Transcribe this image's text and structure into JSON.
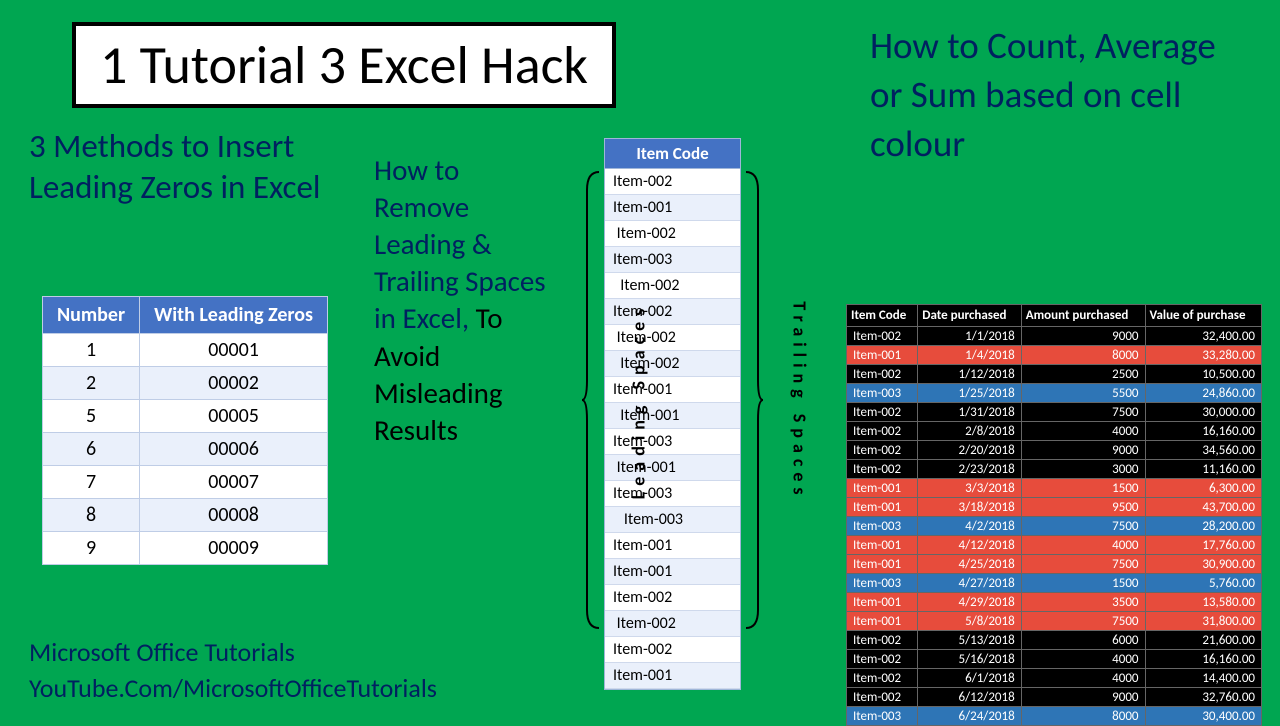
{
  "title": "1 Tutorial 3 Excel Hack",
  "methods_text": "3 Methods to Insert Leading Zeros in Excel",
  "leading_table": {
    "headers": [
      "Number",
      "With Leading Zeros"
    ],
    "rows": [
      [
        "1",
        "00001"
      ],
      [
        "2",
        "00002"
      ],
      [
        "5",
        "00005"
      ],
      [
        "6",
        "00006"
      ],
      [
        "7",
        "00007"
      ],
      [
        "8",
        "00008"
      ],
      [
        "9",
        "00009"
      ]
    ]
  },
  "footer_line1": "Microsoft Office Tutorials",
  "footer_line2": "YouTube.Com/MicrosoftOfficeTutorials",
  "spaces_text_blue": "How to Remove Leading & Trailing Spaces in Excel, ",
  "spaces_text_black": "To Avoid Misleading Results",
  "item_code_header": "Item Code",
  "item_codes": [
    "Item-002",
    "Item-001",
    " Item-002",
    "Item-003",
    "  Item-002",
    "Item-002",
    " Item-002",
    "  Item-002",
    "Item-001",
    "  Item-001",
    "Item-003",
    " Item-001",
    "Item-003",
    "   Item-003",
    "Item-001",
    "Item-001",
    "Item-002",
    " Item-002",
    "Item-002",
    "Item-001"
  ],
  "leading_spaces_label": "Leading Spaces",
  "trailing_spaces_label": "Trailing Spaces",
  "count_text": "How to Count, Average or Sum based on cell colour",
  "color_table": {
    "headers": [
      "Item Code",
      "Date purchased",
      "Amount purchased",
      "Value of purchase"
    ],
    "rows": [
      {
        "c": "black",
        "v": [
          "Item-002",
          "1/1/2018",
          "9000",
          "32,400.00"
        ]
      },
      {
        "c": "red",
        "v": [
          "Item-001",
          "1/4/2018",
          "8000",
          "33,280.00"
        ]
      },
      {
        "c": "black",
        "v": [
          "Item-002",
          "1/12/2018",
          "2500",
          "10,500.00"
        ]
      },
      {
        "c": "blue",
        "v": [
          "Item-003",
          "1/25/2018",
          "5500",
          "24,860.00"
        ]
      },
      {
        "c": "black",
        "v": [
          "Item-002",
          "1/31/2018",
          "7500",
          "30,000.00"
        ]
      },
      {
        "c": "black",
        "v": [
          "Item-002",
          "2/8/2018",
          "4000",
          "16,160.00"
        ]
      },
      {
        "c": "black",
        "v": [
          "Item-002",
          "2/20/2018",
          "9000",
          "34,560.00"
        ]
      },
      {
        "c": "black",
        "v": [
          "Item-002",
          "2/23/2018",
          "3000",
          "11,160.00"
        ]
      },
      {
        "c": "red",
        "v": [
          "Item-001",
          "3/3/2018",
          "1500",
          "6,300.00"
        ]
      },
      {
        "c": "red",
        "v": [
          "Item-001",
          "3/18/2018",
          "9500",
          "43,700.00"
        ]
      },
      {
        "c": "blue",
        "v": [
          "Item-003",
          "4/2/2018",
          "7500",
          "28,200.00"
        ]
      },
      {
        "c": "red",
        "v": [
          "Item-001",
          "4/12/2018",
          "4000",
          "17,760.00"
        ]
      },
      {
        "c": "red",
        "v": [
          "Item-001",
          "4/25/2018",
          "7500",
          "30,900.00"
        ]
      },
      {
        "c": "blue",
        "v": [
          "Item-003",
          "4/27/2018",
          "1500",
          "5,760.00"
        ]
      },
      {
        "c": "red",
        "v": [
          "Item-001",
          "4/29/2018",
          "3500",
          "13,580.00"
        ]
      },
      {
        "c": "red",
        "v": [
          "Item-001",
          "5/8/2018",
          "7500",
          "31,800.00"
        ]
      },
      {
        "c": "black",
        "v": [
          "Item-002",
          "5/13/2018",
          "6000",
          "21,600.00"
        ]
      },
      {
        "c": "black",
        "v": [
          "Item-002",
          "5/16/2018",
          "4000",
          "16,160.00"
        ]
      },
      {
        "c": "black",
        "v": [
          "Item-002",
          "6/1/2018",
          "4000",
          "14,400.00"
        ]
      },
      {
        "c": "black",
        "v": [
          "Item-002",
          "6/12/2018",
          "9000",
          "32,760.00"
        ]
      },
      {
        "c": "blue",
        "v": [
          "Item-003",
          "6/24/2018",
          "8000",
          "30,400.00"
        ]
      }
    ]
  }
}
